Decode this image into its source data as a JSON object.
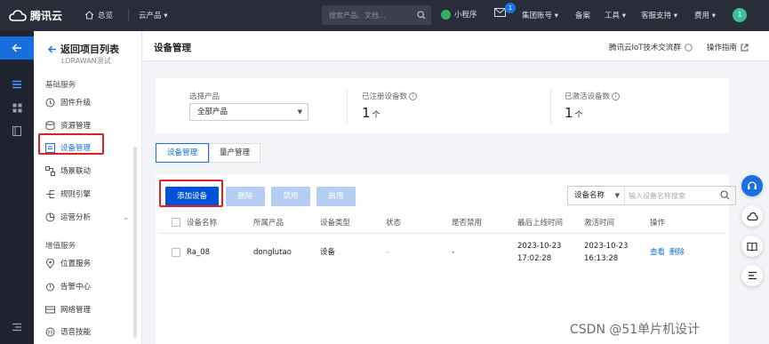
{
  "topbar": {
    "brand": "腾讯云",
    "overview": "总览",
    "cloud_products": "云产品 ▾",
    "search_placeholder": "搜索产品、文档...",
    "mini_program": "小程序",
    "mail_badge": "1",
    "group_account": "集团账号 ▾",
    "filing": "备案",
    "tools": "工具 ▾",
    "support": "客服支持 ▾",
    "billing": "费用 ▾",
    "avatar": "1"
  },
  "sidenav": {
    "back": "返回项目列表",
    "project": "LORAWAN测试",
    "group_basic": "基础服务",
    "items_basic": [
      {
        "label": "固件升级",
        "icon": "firmware-icon"
      },
      {
        "label": "资源管理",
        "icon": "resource-icon"
      },
      {
        "label": "设备管理",
        "icon": "device-icon"
      },
      {
        "label": "场景联动",
        "icon": "scene-icon"
      },
      {
        "label": "规则引擎",
        "icon": "rule-icon"
      },
      {
        "label": "运营分析",
        "icon": "analysis-icon"
      }
    ],
    "group_value": "增值服务",
    "items_value": [
      {
        "label": "位置服务",
        "icon": "location-icon"
      },
      {
        "label": "告警中心",
        "icon": "alarm-icon"
      },
      {
        "label": "网络管理",
        "icon": "network-icon"
      },
      {
        "label": "语音技能",
        "icon": "voice-icon"
      }
    ]
  },
  "header": {
    "title": "设备管理",
    "group_link": "腾讯云IoT技术交流群",
    "guide_link": "操作指南"
  },
  "stats": {
    "select_label": "选择产品",
    "select_value": "全部产品",
    "registered_label": "已注册设备数",
    "registered_value": "1",
    "activated_label": "已激活设备数",
    "activated_value": "1",
    "unit": "个"
  },
  "tabs": [
    "设备管理",
    "量产管理"
  ],
  "toolbar": {
    "add": "添加设备",
    "delete": "删除",
    "disable": "禁用",
    "enable": "启用",
    "filter_field": "设备名称",
    "filter_placeholder": "输入设备名称搜索"
  },
  "table": {
    "columns": [
      "设备名称",
      "所属产品",
      "设备类型",
      "状态",
      "是否禁用",
      "最后上线时间",
      "激活时间",
      "操作"
    ],
    "rows": [
      {
        "name": "Ra_08",
        "product": "donglutao",
        "type": "设备",
        "status": "-",
        "disabled": "-",
        "last_online_date": "2023-10-23",
        "last_online_time": "17:02:28",
        "activated_date": "2023-10-23",
        "activated_time": "16:13:28",
        "action_view": "查看",
        "action_delete": "删除"
      }
    ]
  },
  "watermark": "CSDN @51单片机设计",
  "colors": {
    "primary": "#0052d9",
    "highlight": "#e02020",
    "topbar": "#292d3a"
  }
}
